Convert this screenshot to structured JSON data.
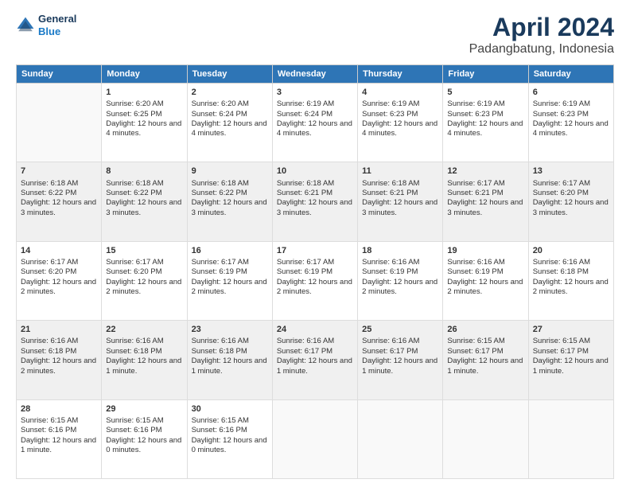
{
  "logo": {
    "general": "General",
    "blue": "Blue"
  },
  "title": "April 2024",
  "subtitle": "Padangbatung, Indonesia",
  "weekdays": [
    "Sunday",
    "Monday",
    "Tuesday",
    "Wednesday",
    "Thursday",
    "Friday",
    "Saturday"
  ],
  "weeks": [
    [
      {
        "day": "",
        "sunrise": "",
        "sunset": "",
        "daylight": ""
      },
      {
        "day": "1",
        "sunrise": "Sunrise: 6:20 AM",
        "sunset": "Sunset: 6:25 PM",
        "daylight": "Daylight: 12 hours and 4 minutes."
      },
      {
        "day": "2",
        "sunrise": "Sunrise: 6:20 AM",
        "sunset": "Sunset: 6:24 PM",
        "daylight": "Daylight: 12 hours and 4 minutes."
      },
      {
        "day": "3",
        "sunrise": "Sunrise: 6:19 AM",
        "sunset": "Sunset: 6:24 PM",
        "daylight": "Daylight: 12 hours and 4 minutes."
      },
      {
        "day": "4",
        "sunrise": "Sunrise: 6:19 AM",
        "sunset": "Sunset: 6:23 PM",
        "daylight": "Daylight: 12 hours and 4 minutes."
      },
      {
        "day": "5",
        "sunrise": "Sunrise: 6:19 AM",
        "sunset": "Sunset: 6:23 PM",
        "daylight": "Daylight: 12 hours and 4 minutes."
      },
      {
        "day": "6",
        "sunrise": "Sunrise: 6:19 AM",
        "sunset": "Sunset: 6:23 PM",
        "daylight": "Daylight: 12 hours and 4 minutes."
      }
    ],
    [
      {
        "day": "7",
        "sunrise": "Sunrise: 6:18 AM",
        "sunset": "Sunset: 6:22 PM",
        "daylight": "Daylight: 12 hours and 3 minutes."
      },
      {
        "day": "8",
        "sunrise": "Sunrise: 6:18 AM",
        "sunset": "Sunset: 6:22 PM",
        "daylight": "Daylight: 12 hours and 3 minutes."
      },
      {
        "day": "9",
        "sunrise": "Sunrise: 6:18 AM",
        "sunset": "Sunset: 6:22 PM",
        "daylight": "Daylight: 12 hours and 3 minutes."
      },
      {
        "day": "10",
        "sunrise": "Sunrise: 6:18 AM",
        "sunset": "Sunset: 6:21 PM",
        "daylight": "Daylight: 12 hours and 3 minutes."
      },
      {
        "day": "11",
        "sunrise": "Sunrise: 6:18 AM",
        "sunset": "Sunset: 6:21 PM",
        "daylight": "Daylight: 12 hours and 3 minutes."
      },
      {
        "day": "12",
        "sunrise": "Sunrise: 6:17 AM",
        "sunset": "Sunset: 6:21 PM",
        "daylight": "Daylight: 12 hours and 3 minutes."
      },
      {
        "day": "13",
        "sunrise": "Sunrise: 6:17 AM",
        "sunset": "Sunset: 6:20 PM",
        "daylight": "Daylight: 12 hours and 3 minutes."
      }
    ],
    [
      {
        "day": "14",
        "sunrise": "Sunrise: 6:17 AM",
        "sunset": "Sunset: 6:20 PM",
        "daylight": "Daylight: 12 hours and 2 minutes."
      },
      {
        "day": "15",
        "sunrise": "Sunrise: 6:17 AM",
        "sunset": "Sunset: 6:20 PM",
        "daylight": "Daylight: 12 hours and 2 minutes."
      },
      {
        "day": "16",
        "sunrise": "Sunrise: 6:17 AM",
        "sunset": "Sunset: 6:19 PM",
        "daylight": "Daylight: 12 hours and 2 minutes."
      },
      {
        "day": "17",
        "sunrise": "Sunrise: 6:17 AM",
        "sunset": "Sunset: 6:19 PM",
        "daylight": "Daylight: 12 hours and 2 minutes."
      },
      {
        "day": "18",
        "sunrise": "Sunrise: 6:16 AM",
        "sunset": "Sunset: 6:19 PM",
        "daylight": "Daylight: 12 hours and 2 minutes."
      },
      {
        "day": "19",
        "sunrise": "Sunrise: 6:16 AM",
        "sunset": "Sunset: 6:19 PM",
        "daylight": "Daylight: 12 hours and 2 minutes."
      },
      {
        "day": "20",
        "sunrise": "Sunrise: 6:16 AM",
        "sunset": "Sunset: 6:18 PM",
        "daylight": "Daylight: 12 hours and 2 minutes."
      }
    ],
    [
      {
        "day": "21",
        "sunrise": "Sunrise: 6:16 AM",
        "sunset": "Sunset: 6:18 PM",
        "daylight": "Daylight: 12 hours and 2 minutes."
      },
      {
        "day": "22",
        "sunrise": "Sunrise: 6:16 AM",
        "sunset": "Sunset: 6:18 PM",
        "daylight": "Daylight: 12 hours and 1 minute."
      },
      {
        "day": "23",
        "sunrise": "Sunrise: 6:16 AM",
        "sunset": "Sunset: 6:18 PM",
        "daylight": "Daylight: 12 hours and 1 minute."
      },
      {
        "day": "24",
        "sunrise": "Sunrise: 6:16 AM",
        "sunset": "Sunset: 6:17 PM",
        "daylight": "Daylight: 12 hours and 1 minute."
      },
      {
        "day": "25",
        "sunrise": "Sunrise: 6:16 AM",
        "sunset": "Sunset: 6:17 PM",
        "daylight": "Daylight: 12 hours and 1 minute."
      },
      {
        "day": "26",
        "sunrise": "Sunrise: 6:15 AM",
        "sunset": "Sunset: 6:17 PM",
        "daylight": "Daylight: 12 hours and 1 minute."
      },
      {
        "day": "27",
        "sunrise": "Sunrise: 6:15 AM",
        "sunset": "Sunset: 6:17 PM",
        "daylight": "Daylight: 12 hours and 1 minute."
      }
    ],
    [
      {
        "day": "28",
        "sunrise": "Sunrise: 6:15 AM",
        "sunset": "Sunset: 6:16 PM",
        "daylight": "Daylight: 12 hours and 1 minute."
      },
      {
        "day": "29",
        "sunrise": "Sunrise: 6:15 AM",
        "sunset": "Sunset: 6:16 PM",
        "daylight": "Daylight: 12 hours and 0 minutes."
      },
      {
        "day": "30",
        "sunrise": "Sunrise: 6:15 AM",
        "sunset": "Sunset: 6:16 PM",
        "daylight": "Daylight: 12 hours and 0 minutes."
      },
      {
        "day": "",
        "sunrise": "",
        "sunset": "",
        "daylight": ""
      },
      {
        "day": "",
        "sunrise": "",
        "sunset": "",
        "daylight": ""
      },
      {
        "day": "",
        "sunrise": "",
        "sunset": "",
        "daylight": ""
      },
      {
        "day": "",
        "sunrise": "",
        "sunset": "",
        "daylight": ""
      }
    ]
  ]
}
